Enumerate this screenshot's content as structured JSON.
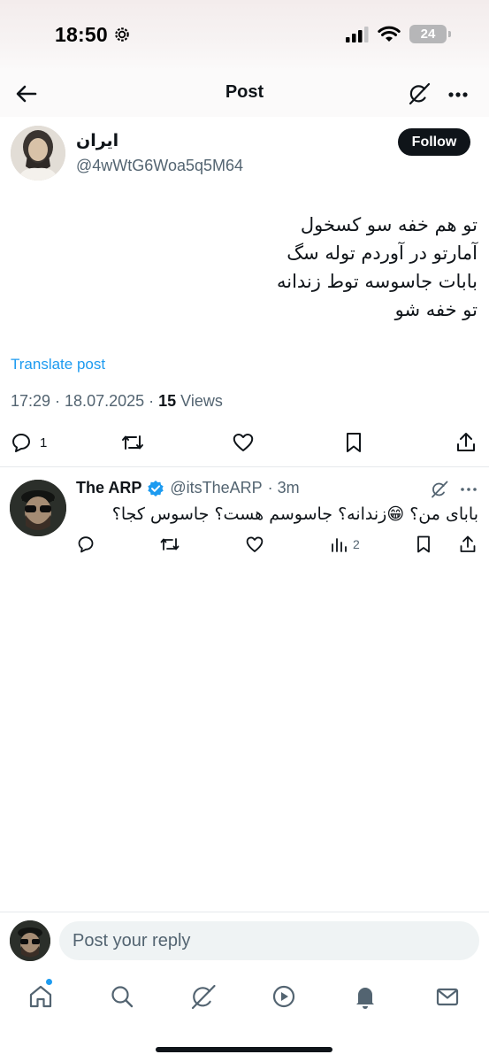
{
  "status_bar": {
    "time": "18:50",
    "battery": "24"
  },
  "header": {
    "title": "Post"
  },
  "post": {
    "author_name": "ایران",
    "author_handle": "@4wWtG6Woa5q5M64",
    "follow_label": "Follow",
    "text_lines": [
      "تو هم خفه سو کسخول",
      "آمارتو در آوردم توله سگ",
      "بابات  جاسوسه توط زندانه",
      "تو خفه شو"
    ],
    "translate_label": "Translate post",
    "timestamp": "17:29 · 18.07.2025 · ",
    "views_count": "15",
    "views_label": " Views",
    "reply_count": "1"
  },
  "reply": {
    "name": "The ARP",
    "handle": "@itsTheARP",
    "time": "· 3m",
    "text": "بابای من؟ 😁زندانه؟ جاسوسم هست؟ جاسوس کجا؟",
    "views_count": "2"
  },
  "composer": {
    "placeholder": "Post your reply"
  },
  "colors": {
    "accent": "#1d9bf0",
    "text": "#0f1419",
    "secondary": "#536471",
    "verified": "#1d9bf0"
  },
  "icons": [
    "back-arrow-icon",
    "grok-icon",
    "more-icon",
    "reply-icon",
    "repost-icon",
    "like-icon",
    "bookmark-icon",
    "share-icon",
    "views-icon",
    "verified-icon",
    "home-icon",
    "search-icon",
    "notifications-icon",
    "video-icon",
    "messages-icon"
  ]
}
